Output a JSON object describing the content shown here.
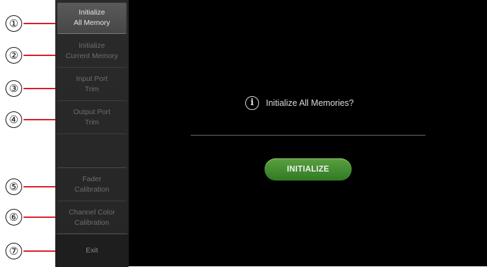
{
  "callouts": [
    "①",
    "②",
    "③",
    "④",
    "⑤",
    "⑥",
    "⑦"
  ],
  "sidebar": {
    "items": [
      {
        "label": "Initialize\nAll Memory",
        "state": "active"
      },
      {
        "label": "Initialize\nCurrent Memory",
        "state": "disabled"
      },
      {
        "label": "Input Port\nTrim",
        "state": "disabled"
      },
      {
        "label": "Output Port\nTrim",
        "state": "disabled"
      },
      {
        "label": "Fader\nCalibration",
        "state": "disabled"
      },
      {
        "label": "Channel Color\nCalibration",
        "state": "disabled"
      },
      {
        "label": "Exit",
        "state": "enabled"
      }
    ]
  },
  "main": {
    "prompt_icon": "info-icon",
    "prompt_text": "Initialize All Memories?",
    "initialize_label": "INITIALIZE"
  },
  "colors": {
    "callout_line": "#d81e2b",
    "button_green": "#3f8c2e",
    "main_bg": "#000000",
    "sidebar_bg": "#2a2a2a"
  }
}
